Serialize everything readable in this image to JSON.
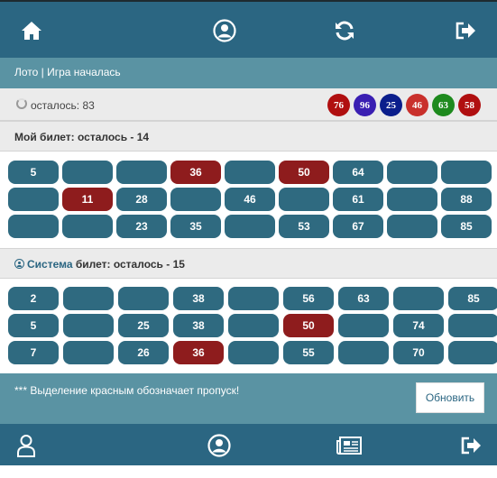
{
  "nav": {
    "icons": [
      "home-icon",
      "user-icon",
      "refresh-icon",
      "logout-icon"
    ]
  },
  "header": {
    "title": "Лото | Игра началась"
  },
  "remaining": {
    "text": "осталось: 83",
    "balls": [
      {
        "number": "76",
        "color": "#b00f10"
      },
      {
        "number": "96",
        "color": "#3a1fb2"
      },
      {
        "number": "25",
        "color": "#0b1e8c"
      },
      {
        "number": "46",
        "color": "#c9302c"
      },
      {
        "number": "63",
        "color": "#1e8a1e"
      },
      {
        "number": "58",
        "color": "#b00f10"
      }
    ]
  },
  "my_ticket": {
    "title": "Мой билет: осталось - 14",
    "rows": [
      [
        {
          "v": "5"
        },
        {
          "v": ""
        },
        {
          "v": ""
        },
        {
          "v": "36",
          "miss": true
        },
        {
          "v": ""
        },
        {
          "v": "50",
          "miss": true
        },
        {
          "v": "64"
        },
        {
          "v": ""
        },
        {
          "v": ""
        }
      ],
      [
        {
          "v": ""
        },
        {
          "v": "11",
          "miss": true
        },
        {
          "v": "28"
        },
        {
          "v": ""
        },
        {
          "v": "46"
        },
        {
          "v": ""
        },
        {
          "v": "61"
        },
        {
          "v": ""
        },
        {
          "v": "88"
        }
      ],
      [
        {
          "v": ""
        },
        {
          "v": ""
        },
        {
          "v": "23"
        },
        {
          "v": "35"
        },
        {
          "v": ""
        },
        {
          "v": "53"
        },
        {
          "v": "67"
        },
        {
          "v": ""
        },
        {
          "v": "85"
        }
      ]
    ]
  },
  "system_ticket": {
    "owner": "Система",
    "rest": "билет: осталось - 15",
    "rows": [
      [
        {
          "v": "2"
        },
        {
          "v": ""
        },
        {
          "v": ""
        },
        {
          "v": "38"
        },
        {
          "v": ""
        },
        {
          "v": "56"
        },
        {
          "v": "63"
        },
        {
          "v": ""
        },
        {
          "v": "85"
        }
      ],
      [
        {
          "v": "5"
        },
        {
          "v": ""
        },
        {
          "v": "25"
        },
        {
          "v": "38"
        },
        {
          "v": ""
        },
        {
          "v": "50",
          "miss": true
        },
        {
          "v": ""
        },
        {
          "v": "74"
        },
        {
          "v": ""
        }
      ],
      [
        {
          "v": "7"
        },
        {
          "v": ""
        },
        {
          "v": "26"
        },
        {
          "v": "36",
          "miss": true
        },
        {
          "v": ""
        },
        {
          "v": "55"
        },
        {
          "v": ""
        },
        {
          "v": "70"
        },
        {
          "v": ""
        }
      ]
    ]
  },
  "footer": {
    "note": "*** Выделение красным обозначает пропуск!",
    "refresh_label": "Обновить"
  },
  "bottom_nav": {
    "icons": [
      "profile-icon",
      "account-icon",
      "news-icon",
      "exit-icon"
    ]
  }
}
